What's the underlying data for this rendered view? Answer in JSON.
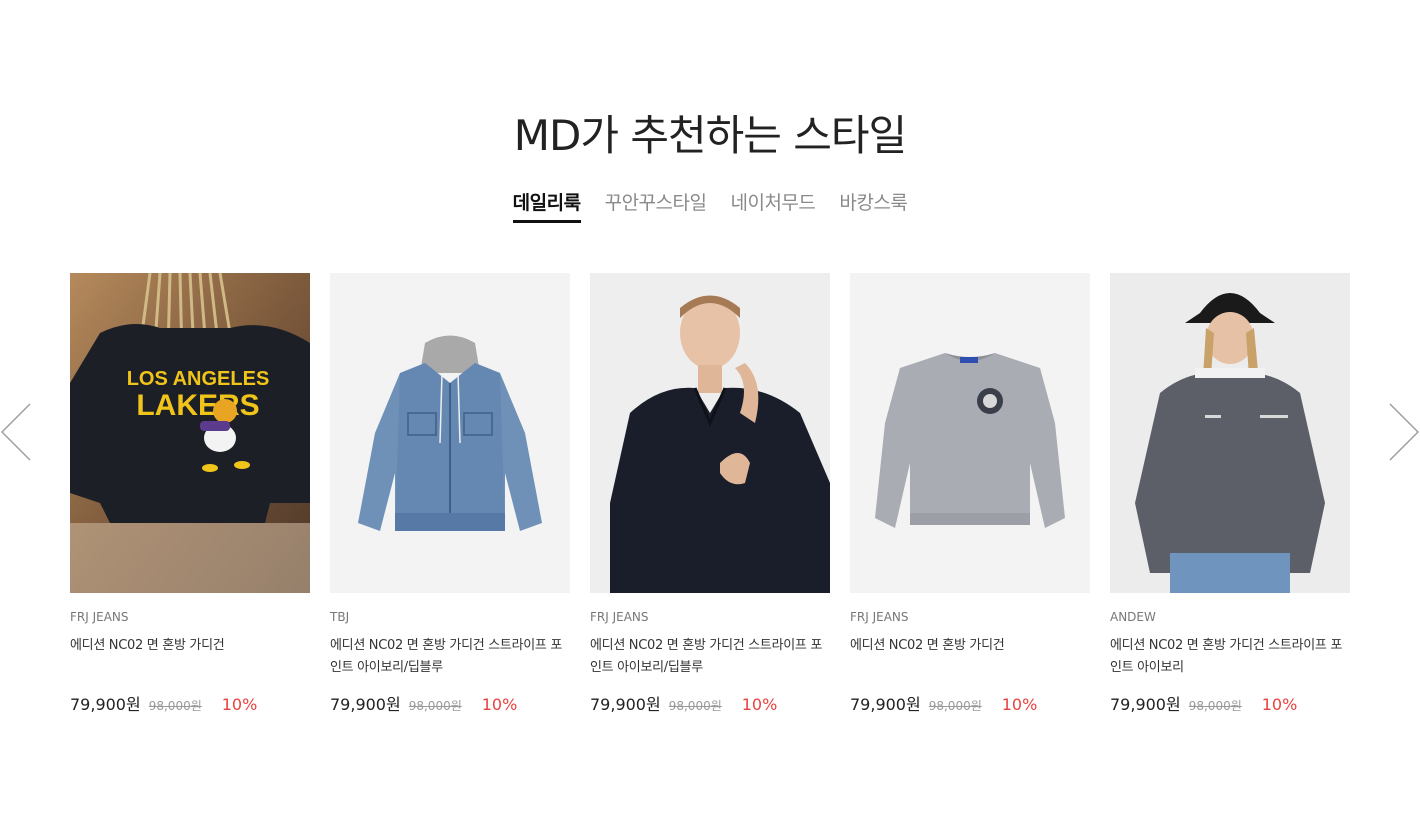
{
  "section": {
    "title": "MD가 추천하는 스타일"
  },
  "tabs": [
    {
      "label": "데일리룩",
      "active": true
    },
    {
      "label": "꾸안꾸스타일",
      "active": false
    },
    {
      "label": "네이처무드",
      "active": false
    },
    {
      "label": "바캉스룩",
      "active": false
    }
  ],
  "carousel": {
    "prev_icon": "chevron-left-icon",
    "next_icon": "chevron-right-icon"
  },
  "products": [
    {
      "brand": "FRJ JEANS",
      "name": "에디션 NC02 면 혼방 가디건",
      "price": "79,900원",
      "original_price": "98,000원",
      "discount": "10%",
      "image": "lakers-tshirt-back-photo",
      "logo_text_1": "LOS ANGELES",
      "logo_text_2": "LAKERS"
    },
    {
      "brand": "TBJ",
      "name": "에디션 NC02 면 혼방 가디건 스트라이프 포인트 아이보리/딥블루",
      "price": "79,900원",
      "original_price": "98,000원",
      "discount": "10%",
      "image": "hooded-denim-jacket-photo"
    },
    {
      "brand": "FRJ JEANS",
      "name": "에디션 NC02 면 혼방 가디건 스트라이프 포인트 아이보리/딥블루",
      "price": "79,900원",
      "original_price": "98,000원",
      "discount": "10%",
      "image": "model-navy-shirt-photo"
    },
    {
      "brand": "FRJ JEANS",
      "name": "에디션 NC02 면 혼방 가디건",
      "price": "79,900원",
      "original_price": "98,000원",
      "discount": "10%",
      "image": "grey-sweatshirt-photo"
    },
    {
      "brand": "ANDEW",
      "name": "에디션 NC02 면 혼방 가디건 스트라이프 포인트 아이보리",
      "price": "79,900원",
      "original_price": "98,000원",
      "discount": "10%",
      "image": "model-charcoal-sweatshirt-bucket-hat-photo"
    }
  ],
  "colors": {
    "discount": "#e8423f",
    "active_tab": "#111111",
    "inactive_tab": "#8a8a8a"
  }
}
